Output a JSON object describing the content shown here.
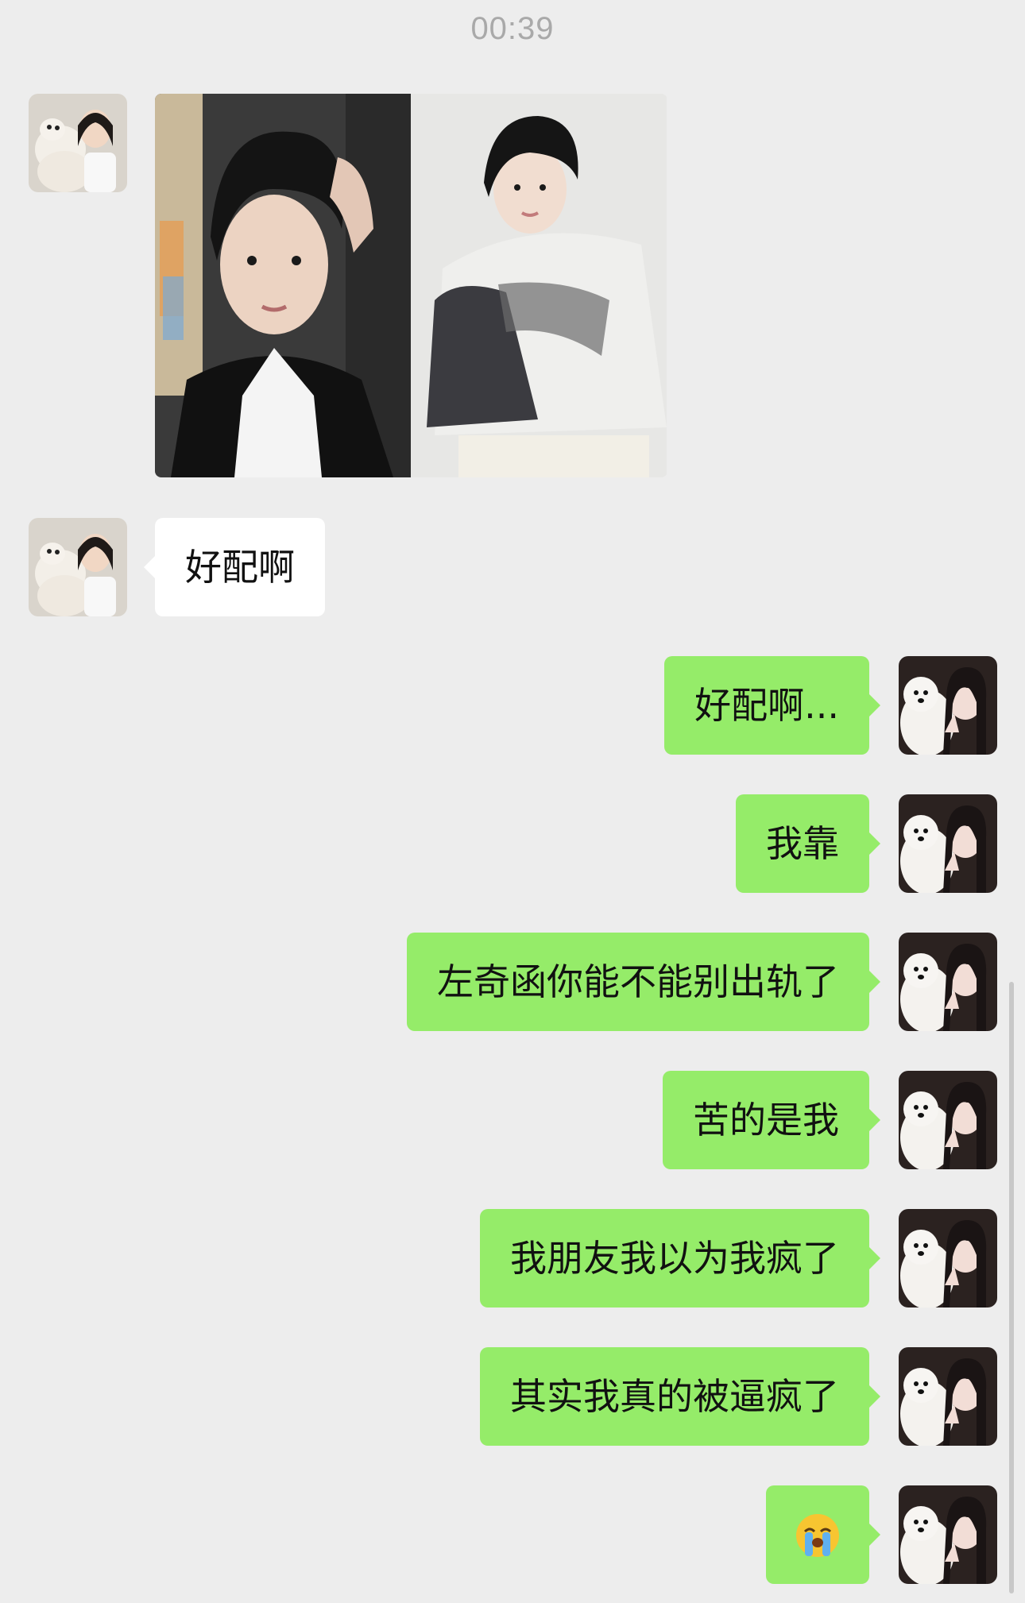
{
  "timestamp": "00:39",
  "chat": {
    "incoming_image": {
      "description_icon": "photo-collage-icon"
    },
    "incoming_text": "好配啊",
    "outgoing": [
      "好配啊...",
      "我靠",
      "左奇函你能不能别出轨了",
      "苦的是我",
      "我朋友我以为我疯了",
      "其实我真的被逼疯了"
    ],
    "outgoing_emoji": "loudly-crying-face-icon"
  },
  "colors": {
    "background": "#ededed",
    "incoming_bubble": "#ffffff",
    "outgoing_bubble": "#95ec69",
    "timestamp_text": "#a9a9a9"
  }
}
